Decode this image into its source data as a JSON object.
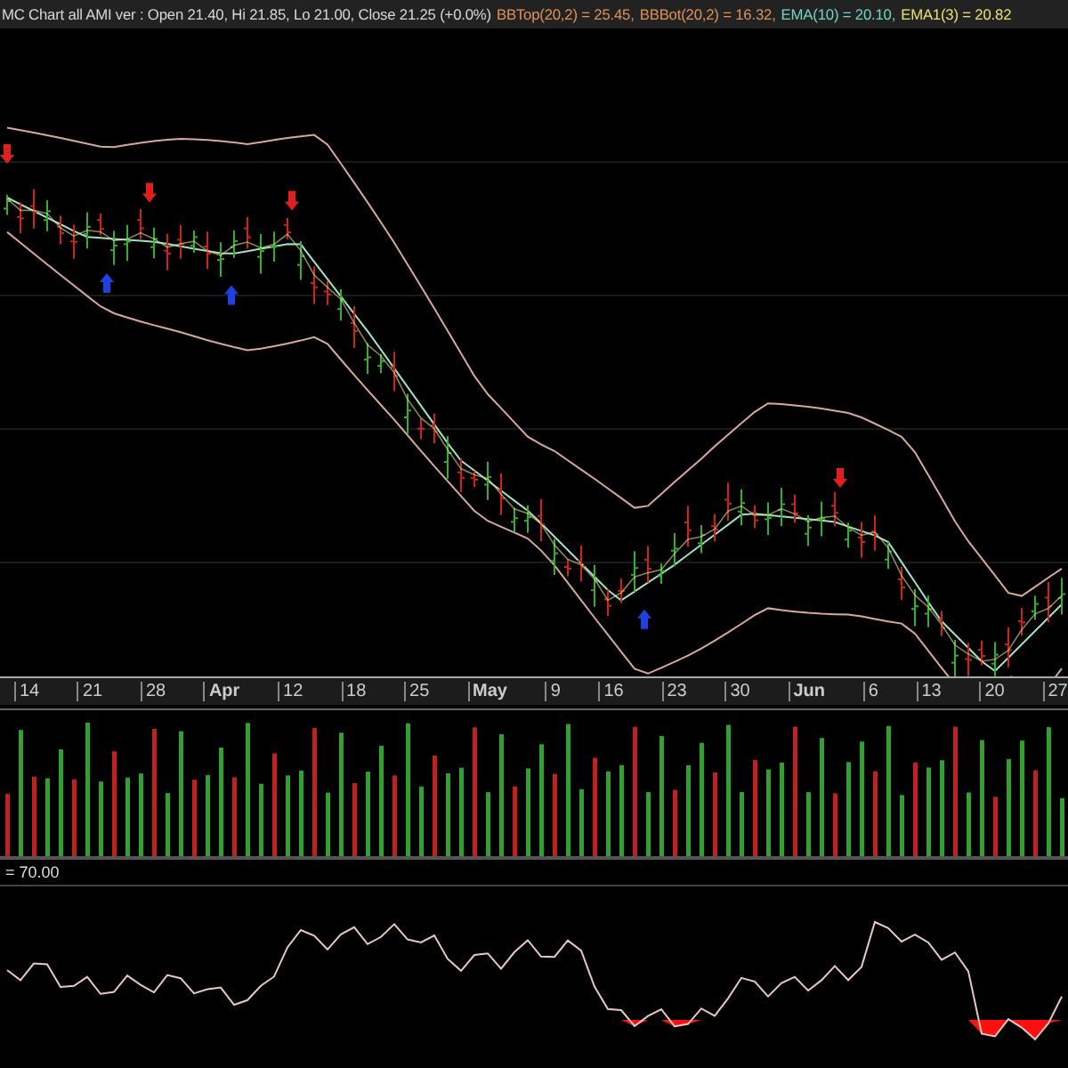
{
  "header": [
    {
      "text": "MC Chart all AMI ver : Open 21.40, Hi 21.85, Lo 21.00, Close 21.25 (+0.0%)",
      "color": "#d8d8d8"
    },
    {
      "text": "BBTop(20,2) = 25.45,",
      "color": "#e0905a"
    },
    {
      "text": "BBBot(20,2) = 16.32,",
      "color": "#e0905a"
    },
    {
      "text": "EMA(10) = 20.10,",
      "color": "#6fd6c0"
    },
    {
      "text": "EMA1(3) = 20.82",
      "color": "#e8e070"
    }
  ],
  "x_axis": [
    {
      "label": "14",
      "kind": "day"
    },
    {
      "label": "21",
      "kind": "day"
    },
    {
      "label": "28",
      "kind": "day"
    },
    {
      "label": "Apr",
      "kind": "month"
    },
    {
      "label": "12",
      "kind": "day"
    },
    {
      "label": "18",
      "kind": "day"
    },
    {
      "label": "25",
      "kind": "day"
    },
    {
      "label": "May",
      "kind": "month"
    },
    {
      "label": "9",
      "kind": "day"
    },
    {
      "label": "16",
      "kind": "day"
    },
    {
      "label": "23",
      "kind": "day"
    },
    {
      "label": "30",
      "kind": "day"
    },
    {
      "label": "Jun",
      "kind": "month"
    },
    {
      "label": "6",
      "kind": "day"
    },
    {
      "label": "13",
      "kind": "day"
    },
    {
      "label": "20",
      "kind": "day"
    },
    {
      "label": "27",
      "kind": "day"
    }
  ],
  "oscillator": {
    "label": "= 70.00"
  }
}
